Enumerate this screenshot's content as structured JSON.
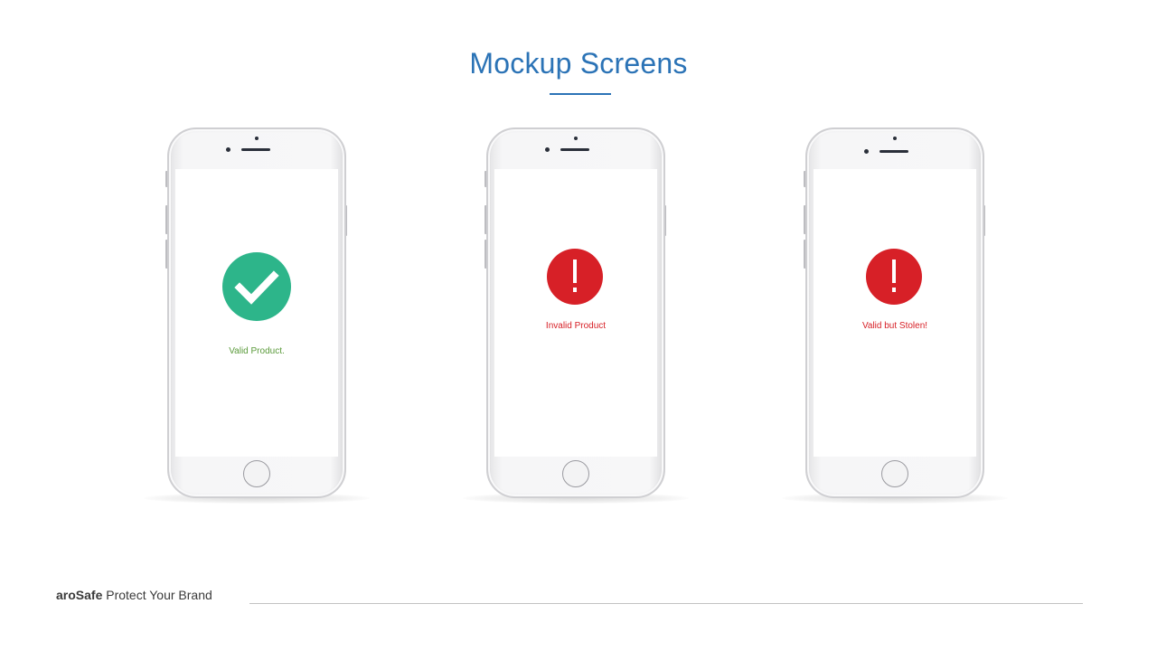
{
  "slide": {
    "title": "Mockup Screens",
    "accent_color": "#2b73b6"
  },
  "phones": [
    {
      "status": "valid",
      "icon": "checkmark-icon",
      "icon_color": "#2db58a",
      "label": "Valid Product.",
      "label_color": "#5a9a3a"
    },
    {
      "status": "invalid",
      "icon": "exclamation-icon",
      "icon_color": "#d72027",
      "label": "Invalid Product",
      "label_color": "#d72027"
    },
    {
      "status": "stolen",
      "icon": "exclamation-icon",
      "icon_color": "#d72027",
      "label": "Valid but Stolen!",
      "label_color": "#d72027"
    }
  ],
  "footer": {
    "brand_bold": "aroSafe",
    "brand_tagline": " Protect Your Brand"
  }
}
